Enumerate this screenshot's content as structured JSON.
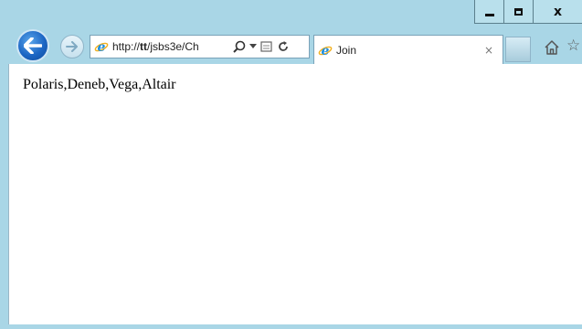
{
  "window": {
    "caption_buttons": {
      "minimize_label": "",
      "maximize_label": "",
      "close_label": "x"
    }
  },
  "address_bar": {
    "url_prefix": "http://",
    "url_host": "tt",
    "url_path": "/jsbs3e/Ch"
  },
  "tab": {
    "title": "Join",
    "close_glyph": "×"
  },
  "page": {
    "content_text": "Polaris,Deneb,Vega,Altair"
  },
  "colors": {
    "frame": "#a9d6e6",
    "back_button": "#1c66c4",
    "ie_logo": "#1e8fe0",
    "ie_ring": "#f2b01e"
  },
  "icons": [
    "back-arrow-icon",
    "forward-arrow-icon",
    "ie-logo-icon",
    "search-icon",
    "dropdown-icon",
    "compatibility-view-icon",
    "refresh-icon",
    "home-icon",
    "favorites-star-icon"
  ]
}
